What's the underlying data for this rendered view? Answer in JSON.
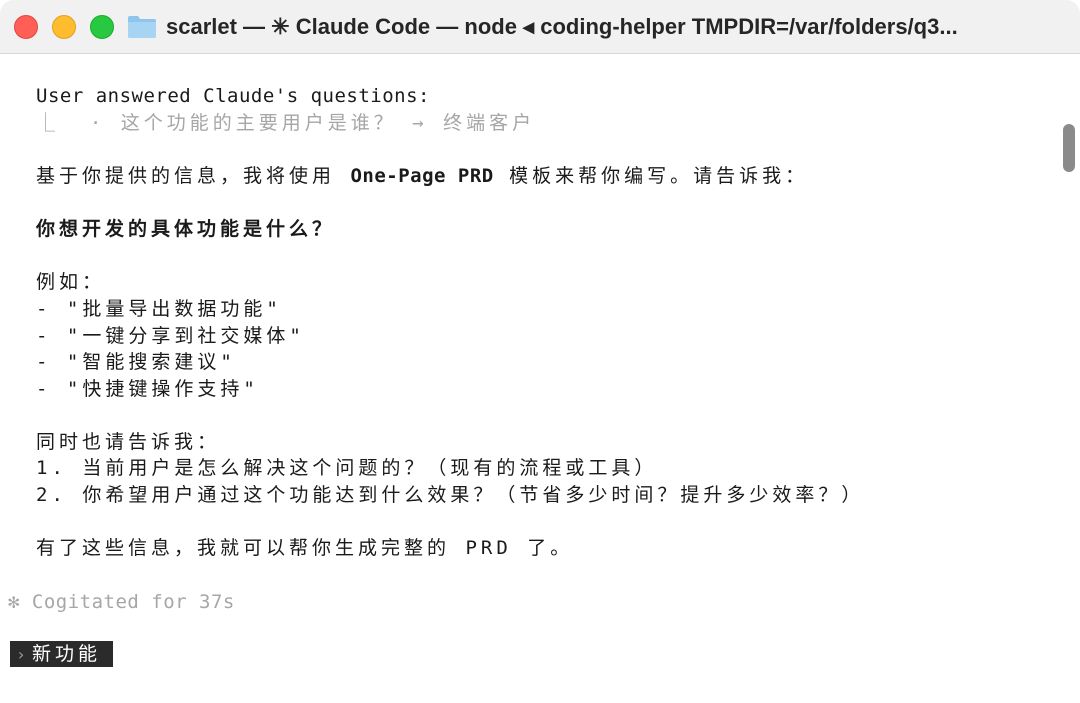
{
  "window": {
    "title": "scarlet — ✳ Claude Code — node ◂ coding-helper TMPDIR=/var/folders/q3..."
  },
  "terminal": {
    "answered_header": "User answered Claude's questions:",
    "answered_line": "⎿  · 这个功能的主要用户是谁？ → 终端客户",
    "intro_prefix": "基于你提供的信息，我将使用 ",
    "intro_bold": "One-Page PRD",
    "intro_suffix": " 模板来帮你编写。请告诉我：",
    "question": "你想开发的具体功能是什么？",
    "example_header": "例如：",
    "examples": [
      "- \"批量导出数据功能\"",
      "- \"一键分享到社交媒体\"",
      "- \"智能搜索建议\"",
      "- \"快捷键操作支持\""
    ],
    "also_tell": "同时也请告诉我：",
    "followups": [
      "1. 当前用户是怎么解决这个问题的？（现有的流程或工具）",
      "2. 你希望用户通过这个功能达到什么效果？（节省多少时间？提升多少效率？）"
    ],
    "closing": "有了这些信息，我就可以帮你生成完整的 PRD 了。",
    "status": "✻ Cogitated for 37s",
    "prompt_arrow": "›",
    "prompt_input": "新功能"
  }
}
